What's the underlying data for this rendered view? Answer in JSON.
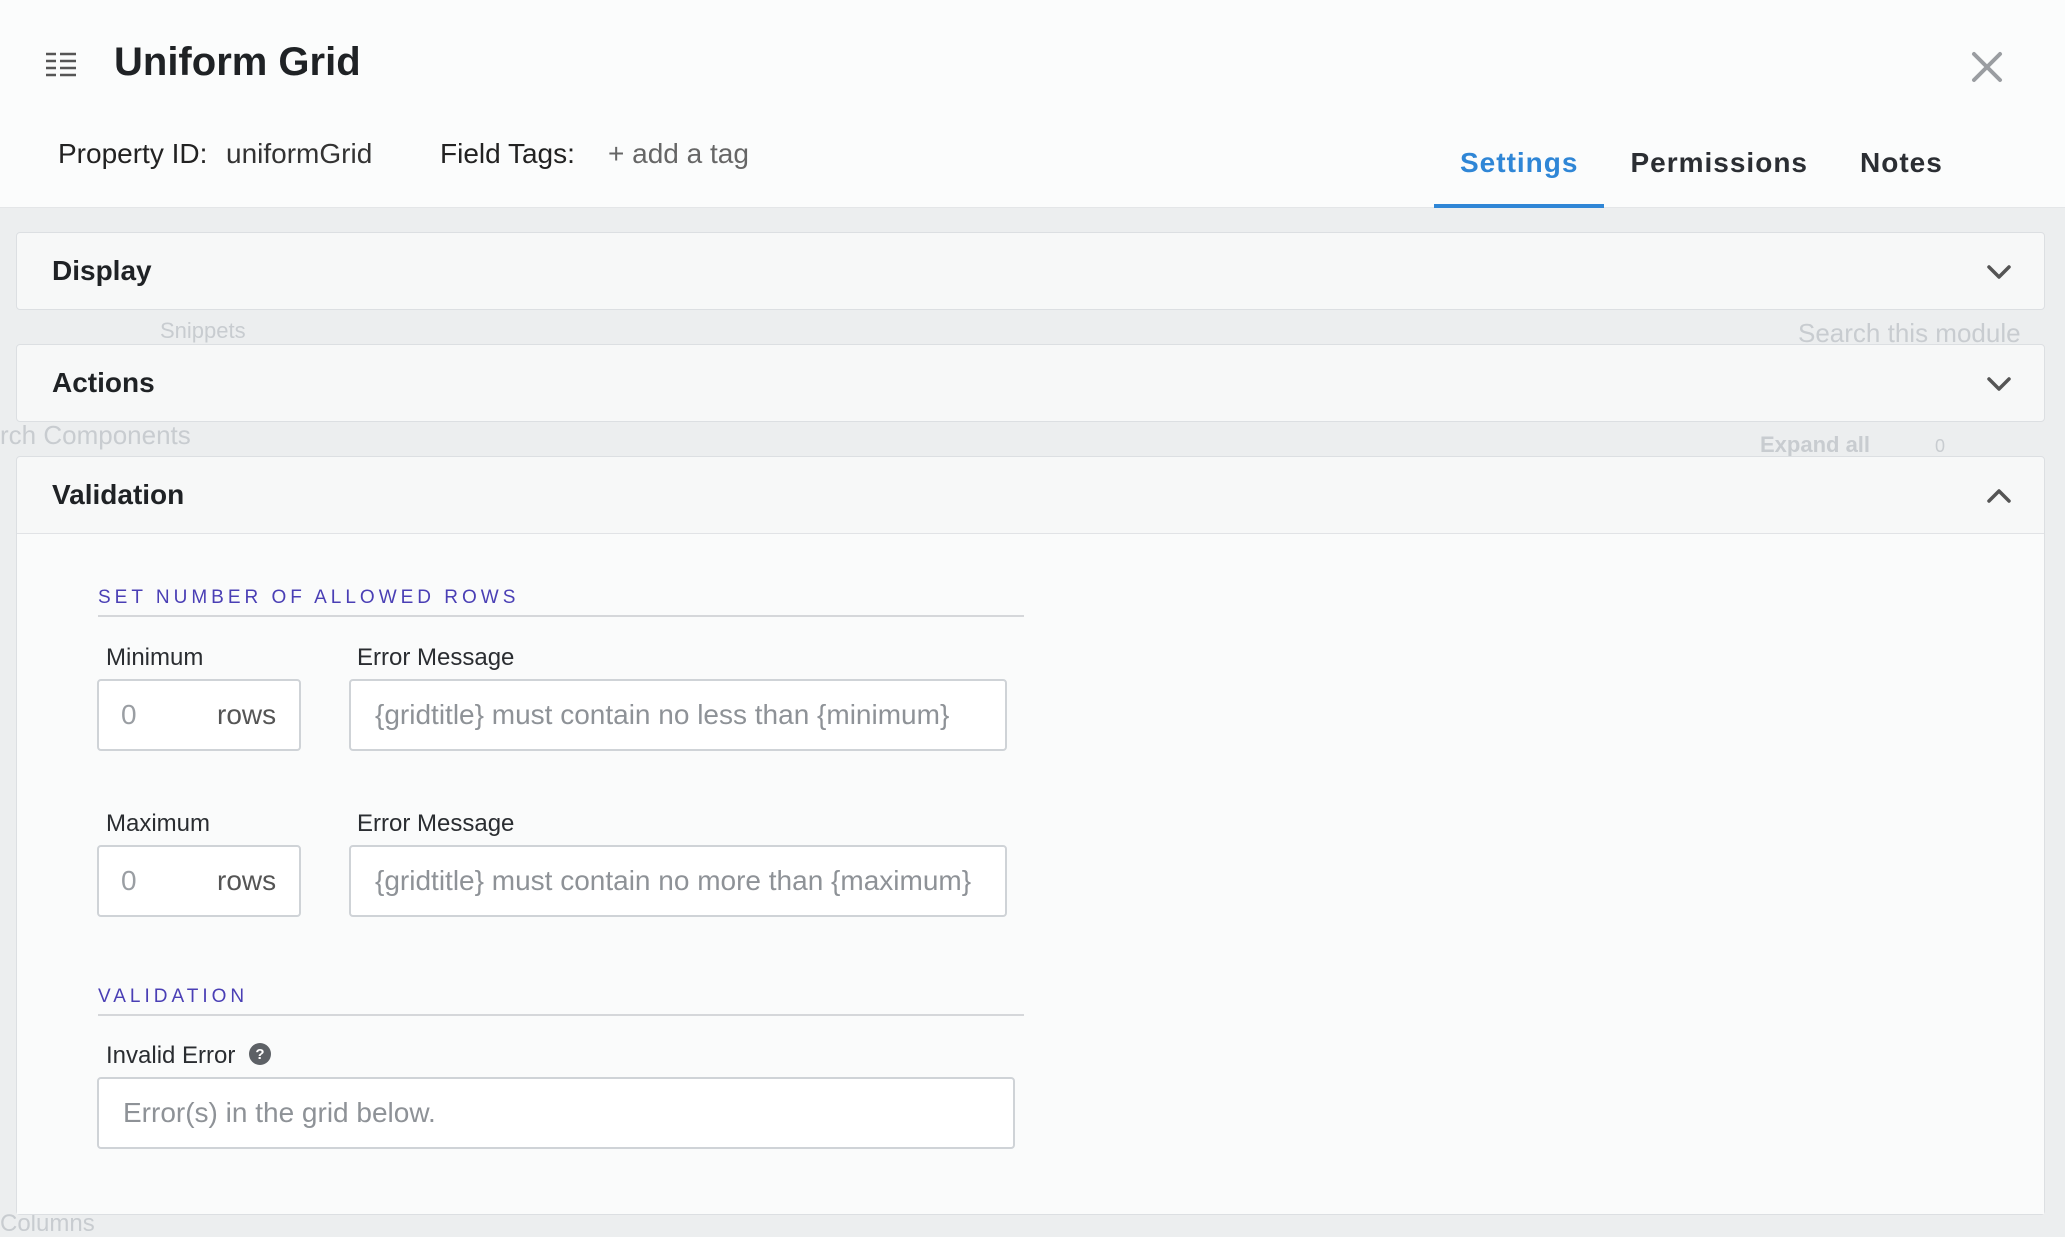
{
  "background": {
    "texts": [
      "Snippets",
      "Search this module",
      "rch Components",
      "Expand all",
      "0",
      "Columns"
    ]
  },
  "header": {
    "title": "Uniform Grid",
    "property_id_label": "Property ID:",
    "property_id_value": "uniformGrid",
    "field_tags_label": "Field Tags:",
    "add_tag_label": "+ add a tag",
    "tabs": [
      {
        "label": "Settings",
        "active": true
      },
      {
        "label": "Permissions",
        "active": false
      },
      {
        "label": "Notes",
        "active": false
      }
    ]
  },
  "panels": {
    "display": {
      "label": "Display",
      "expanded": false
    },
    "actions": {
      "label": "Actions",
      "expanded": false
    },
    "validation": {
      "label": "Validation",
      "expanded": true
    }
  },
  "validation": {
    "rows_section_title": "SET NUMBER OF ALLOWED ROWS",
    "minimum": {
      "label": "Minimum",
      "value": "0",
      "unit": "rows",
      "error_label": "Error Message",
      "error_placeholder": "{gridtitle} must contain no less than {minimum}"
    },
    "maximum": {
      "label": "Maximum",
      "value": "0",
      "unit": "rows",
      "error_label": "Error Message",
      "error_placeholder": "{gridtitle} must contain no more than {maximum}"
    },
    "validation_section_title": "VALIDATION",
    "invalid_error": {
      "label": "Invalid Error",
      "placeholder": "Error(s) in the grid below."
    }
  },
  "colors": {
    "accent": "#2f86d6",
    "section_title": "#4a3fb5"
  },
  "icons": [
    "list-icon",
    "close-icon",
    "chevron-down-icon",
    "chevron-up-icon",
    "help-icon"
  ]
}
